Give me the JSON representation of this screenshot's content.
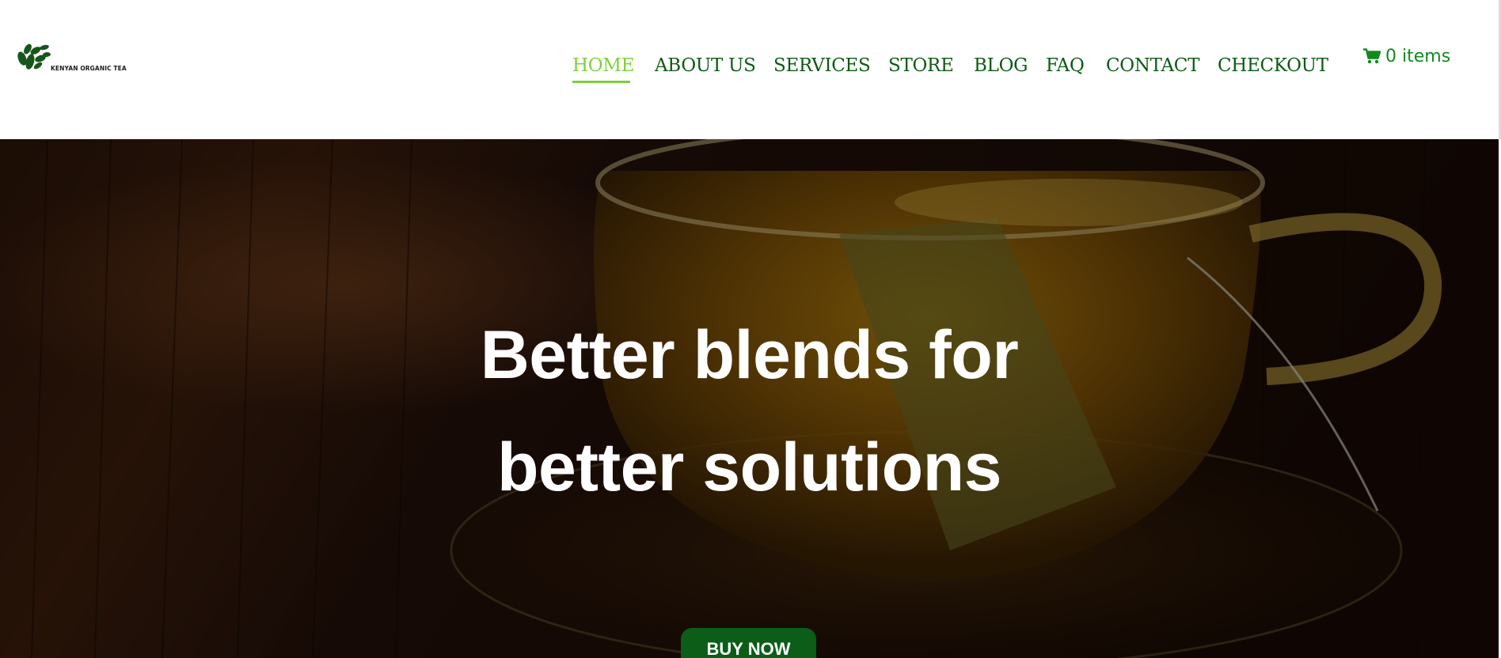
{
  "brand": {
    "logo_text": "KENYAN ORGANIC TEA",
    "logo_icon": "tea-leaves-logo"
  },
  "nav": {
    "items": [
      {
        "label": "HOME",
        "active": true
      },
      {
        "label": "ABOUT US",
        "active": false
      },
      {
        "label": "SERVICES",
        "active": false
      },
      {
        "label": "STORE",
        "active": false
      },
      {
        "label": "BLOG",
        "active": false
      },
      {
        "label": "FAQ",
        "active": false
      },
      {
        "label": "CONTACT",
        "active": false
      },
      {
        "label": "CHECKOUT",
        "active": false
      }
    ]
  },
  "cart": {
    "label": "0 items",
    "icon": "shopping-cart-icon"
  },
  "hero": {
    "title_line1": "Better blends for",
    "title_line2": "better solutions",
    "cta_label": "BUY NOW",
    "background": "tea-cup-photo"
  },
  "colors": {
    "nav_text": "#0d5a14",
    "nav_active": "#7cd13a",
    "cart": "#118a1c",
    "button_bg": "#0b5d17"
  }
}
